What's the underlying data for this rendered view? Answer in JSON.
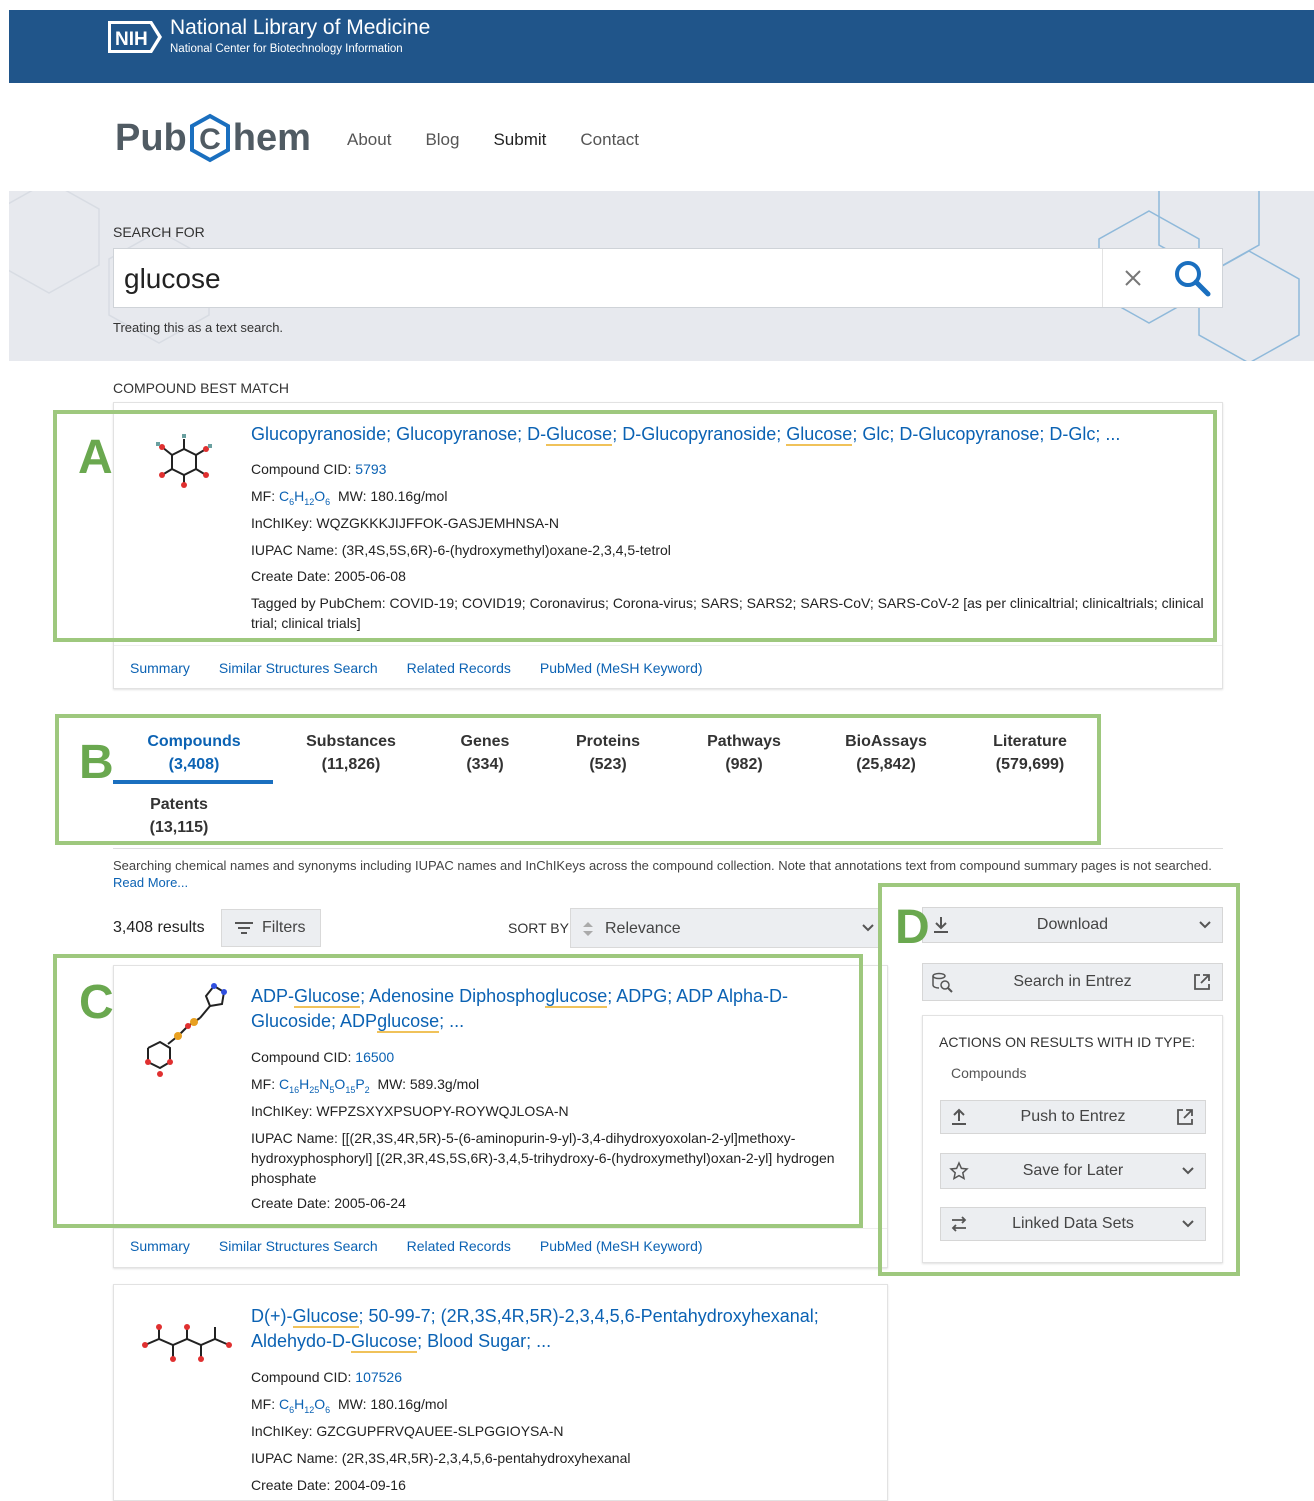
{
  "header": {
    "nih_badge": "NIH",
    "org_title": "National Library of Medicine",
    "org_subtitle": "National Center for Biotechnology Information"
  },
  "site": {
    "logo_left": "Pub",
    "logo_mid": "C",
    "logo_right": "hem",
    "nav": [
      "About",
      "Blog",
      "Submit",
      "Contact"
    ]
  },
  "search": {
    "label": "SEARCH FOR",
    "value": "glucose",
    "hint": "Treating this as a text search."
  },
  "best_match": {
    "section_label": "COMPOUND BEST MATCH",
    "title_parts": [
      "Glucopyranoside; Glucopyranose; D-",
      "Glucose",
      "; D-Glucopyranoside; ",
      "Glucose",
      "; Glc; D-Glucopyranose; D-Glc; ..."
    ],
    "cid_label": "Compound CID: ",
    "cid": "5793",
    "mf_label": "MF: ",
    "mf": [
      "C",
      "6",
      "H",
      "12",
      "O",
      "6"
    ],
    "mw": "MW: 180.16g/mol",
    "inchikey": "InChIKey: WQZGKKKJIJFFOK-GASJEMHNSA-N",
    "iupac": "IUPAC Name: (3R,4S,5S,6R)-6-(hydroxymethyl)oxane-2,3,4,5-tetrol",
    "create_date": "Create Date: 2005-06-08",
    "tagged": "Tagged by PubChem: COVID-19; COVID19; Coronavirus; Corona-virus; SARS; SARS2; SARS-CoV; SARS-CoV-2 [as per clinicaltrial; clinicaltrials; clinical trial; clinical trials]",
    "links": [
      "Summary",
      "Similar Structures Search",
      "Related Records",
      "PubMed (MeSH Keyword)"
    ]
  },
  "tabs": [
    {
      "name": "Compounds",
      "count": "(3,408)"
    },
    {
      "name": "Substances",
      "count": "(11,826)"
    },
    {
      "name": "Genes",
      "count": "(334)"
    },
    {
      "name": "Proteins",
      "count": "(523)"
    },
    {
      "name": "Pathways",
      "count": "(982)"
    },
    {
      "name": "BioAssays",
      "count": "(25,842)"
    },
    {
      "name": "Literature",
      "count": "(579,699)"
    },
    {
      "name": "Patents",
      "count": "(13,115)"
    }
  ],
  "note": {
    "text": "Searching chemical names and synonyms including IUPAC names and InChIKeys across the compound collection. Note that annotations text from compound summary pages is not searched. ",
    "link": "Read More..."
  },
  "results": {
    "count": "3,408 results",
    "filters": "Filters",
    "sort_label": "SORT BY",
    "sort_value": "Relevance",
    "items": [
      {
        "title_l1": [
          "ADP-",
          "Glucose",
          "; Adenosine Diphospho",
          "glucose",
          "; ADPG; ADP Alpha-D-"
        ],
        "title_l2": [
          "Glucoside; ADP",
          "glucose",
          "; ..."
        ],
        "cid_label": "Compound CID: ",
        "cid": "16500",
        "mf_label": "MF: ",
        "mf": [
          "C",
          "16",
          "H",
          "25",
          "N",
          "5",
          "O",
          "15",
          "P",
          "2"
        ],
        "mw": "MW: 589.3g/mol",
        "inchikey": "InChIKey: WFPZSXYXPSUOPY-ROYWQJLOSA-N",
        "iupac": "IUPAC Name: [[(2R,3S,4R,5R)-5-(6-aminopurin-9-yl)-3,4-dihydroxyoxolan-2-yl]methoxy-hydroxyphosphoryl] [(2R,3R,4S,5S,6R)-3,4,5-trihydroxy-6-(hydroxymethyl)oxan-2-yl] hydrogen phosphate",
        "create_date": "Create Date: 2005-06-24",
        "links": [
          "Summary",
          "Similar Structures Search",
          "Related Records",
          "PubMed (MeSH Keyword)"
        ]
      },
      {
        "title_l1": [
          "D(+)-",
          "Glucose",
          "; 50-99-7; (2R,3S,4R,5R)-2,3,4,5,6-Pentahydroxyhexanal;"
        ],
        "title_l2": [
          "Aldehydo-D-",
          "Glucose",
          "; Blood Sugar; ..."
        ],
        "cid_label": "Compound CID: ",
        "cid": "107526",
        "mf_label": "MF: ",
        "mf": [
          "C",
          "6",
          "H",
          "12",
          "O",
          "6"
        ],
        "mw": "MW: 180.16g/mol",
        "inchikey": "InChIKey: GZCGUPFRVQAUEE-SLPGGIOYSA-N",
        "iupac": "IUPAC Name: (2R,3S,4R,5R)-2,3,4,5,6-pentahydroxyhexanal",
        "create_date": "Create Date: 2004-09-16"
      }
    ]
  },
  "sidebar": {
    "download": "Download",
    "search_entrez": "Search in Entrez",
    "actions_title": "ACTIONS ON RESULTS WITH ID TYPE:",
    "actions_type": "Compounds",
    "push": "Push to Entrez",
    "save": "Save for Later",
    "linked": "Linked Data Sets"
  },
  "annotations": [
    "A",
    "B",
    "C",
    "D"
  ],
  "colors": {
    "nih_blue": "#20558a",
    "link_blue": "#0b62b3",
    "annotation_green": "#9ec87e",
    "highlight": "#f0c25a"
  }
}
